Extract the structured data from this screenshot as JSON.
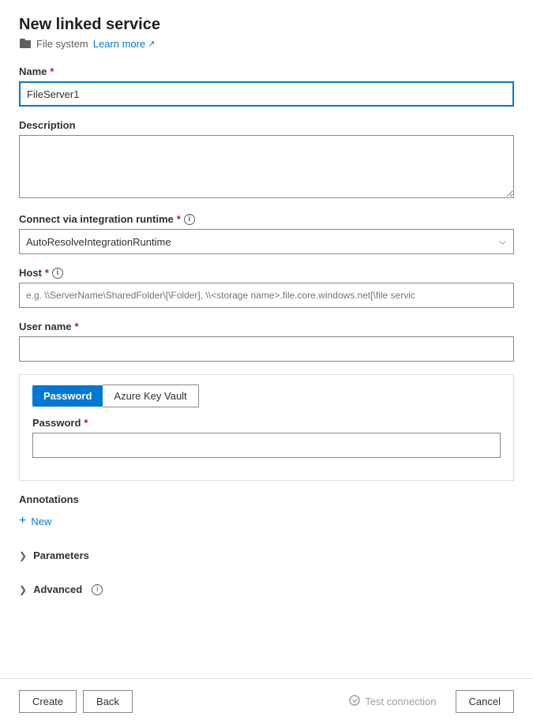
{
  "header": {
    "title": "New linked service",
    "subtitle": "File system",
    "learn_more": "Learn more",
    "external_icon": "↗"
  },
  "form": {
    "name_label": "Name",
    "name_required": "*",
    "name_value": "FileServer1",
    "description_label": "Description",
    "description_placeholder": "",
    "integration_runtime_label": "Connect via integration runtime",
    "integration_runtime_required": "*",
    "integration_runtime_value": "AutoResolveIntegrationRuntime",
    "host_label": "Host",
    "host_required": "*",
    "host_placeholder": "e.g. \\\\ServerName\\SharedFolder\\[\\Folder], \\\\<storage name>.file.core.windows.net[\\file servic",
    "username_label": "User name",
    "username_required": "*",
    "username_value": "",
    "password_tab_label": "Password",
    "azure_key_vault_tab_label": "Azure Key Vault",
    "password_field_label": "Password",
    "password_required": "*",
    "password_value": ""
  },
  "annotations": {
    "label": "Annotations",
    "new_button": "New"
  },
  "parameters": {
    "label": "Parameters"
  },
  "advanced": {
    "label": "Advanced"
  },
  "footer": {
    "create_label": "Create",
    "back_label": "Back",
    "test_connection_label": "Test connection",
    "cancel_label": "Cancel"
  }
}
